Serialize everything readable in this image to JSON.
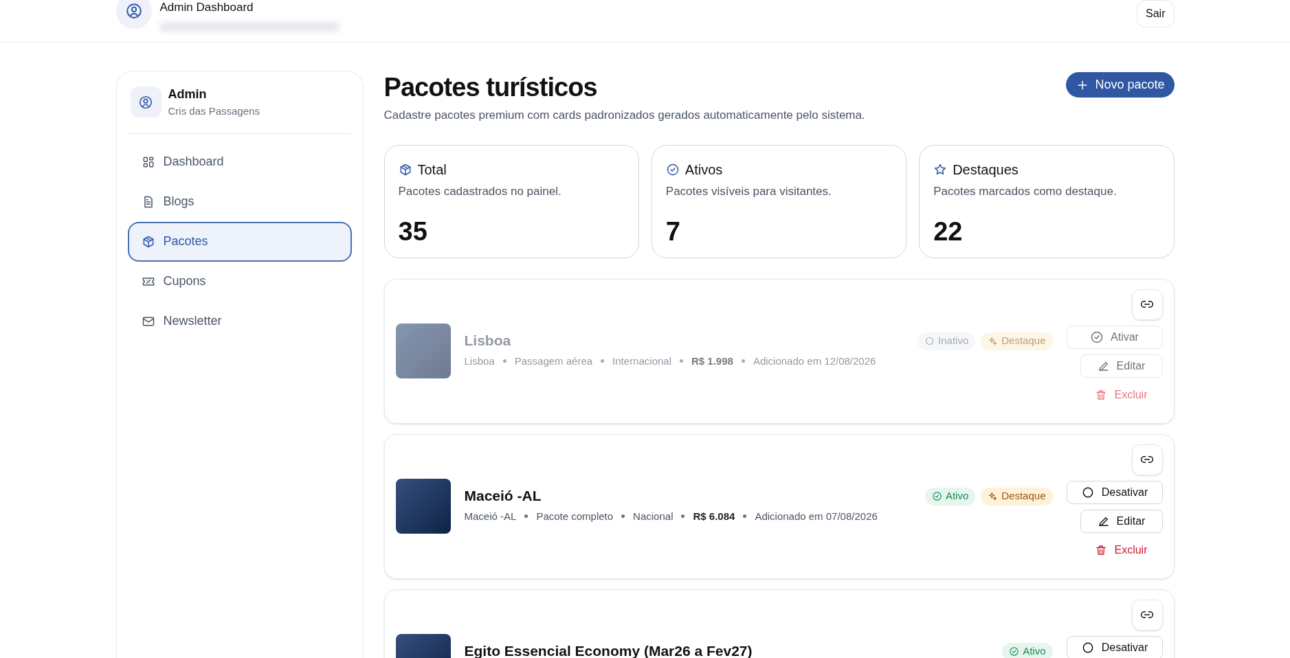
{
  "header": {
    "title": "Admin Dashboard",
    "logout": "Sair"
  },
  "sidebar": {
    "user": {
      "name": "Admin",
      "subtitle": "Cris das Passagens"
    },
    "items": [
      {
        "label": "Dashboard",
        "kind": "grid",
        "selected": false
      },
      {
        "label": "Blogs",
        "kind": "document",
        "selected": false
      },
      {
        "label": "Pacotes",
        "kind": "package",
        "selected": true
      },
      {
        "label": "Cupons",
        "kind": "ticket",
        "selected": false
      },
      {
        "label": "Newsletter",
        "kind": "mail",
        "selected": false
      }
    ]
  },
  "page": {
    "title": "Pacotes turísticos",
    "subtitle": "Cadastre pacotes premium com cards padronizados gerados automaticamente pelo sistema.",
    "new_button": "Novo pacote"
  },
  "stats": [
    {
      "kind": "package",
      "title": "Total",
      "description": "Pacotes cadastrados no painel.",
      "value": "35"
    },
    {
      "kind": "check",
      "title": "Ativos",
      "description": "Pacotes visíveis para visitantes.",
      "value": "7"
    },
    {
      "kind": "star",
      "title": "Destaques",
      "description": "Pacotes marcados como destaque.",
      "value": "22"
    }
  ],
  "packages": [
    {
      "name": "Lisboa",
      "active": false,
      "status": "Inativo",
      "featured": "Destaque",
      "meta": [
        "Lisboa",
        "Passagem aérea",
        "Internacional"
      ],
      "price": "R$ 1.998",
      "added": "Adicionado em 12/08/2026",
      "toggle": "Ativar",
      "edit": "Editar",
      "delete": "Excluir"
    },
    {
      "name": "Maceió -AL",
      "active": true,
      "status": "Ativo",
      "featured": "Destaque",
      "meta": [
        "Maceió -AL",
        "Pacote completo",
        "Nacional"
      ],
      "price": "R$ 6.084",
      "added": "Adicionado em 07/08/2026",
      "toggle": "Desativar",
      "edit": "Editar",
      "delete": "Excluir"
    },
    {
      "name": "Egito Essencial Economy (Mar26 a Fev27)",
      "active": true,
      "status": "Ativo",
      "toggle": "Desativar"
    }
  ]
}
